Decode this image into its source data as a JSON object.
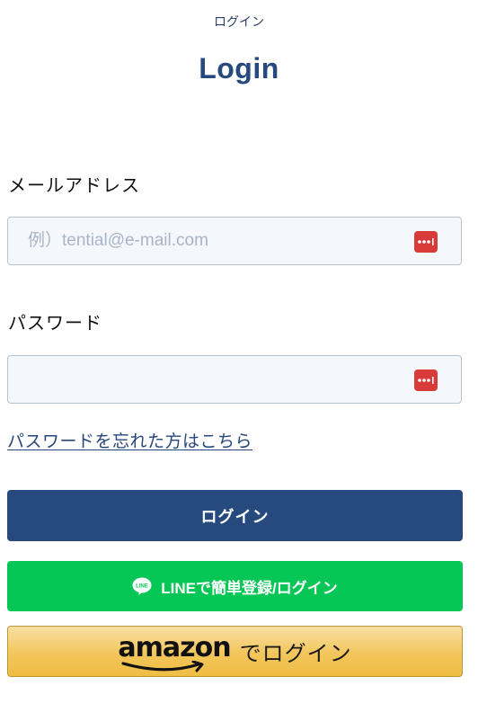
{
  "header": {
    "small_title": "ログイン",
    "title": "Login"
  },
  "email": {
    "label": "メールアドレス",
    "placeholder": "例）tential@e-mail.com",
    "value": ""
  },
  "password": {
    "label": "パスワード",
    "placeholder": "",
    "value": ""
  },
  "forgot_password": {
    "label": "パスワードを忘れた方はこちら"
  },
  "buttons": {
    "login_label": "ログイン",
    "line_label": "LINEで簡単登録/ログイン",
    "line_icon_text": "LINE",
    "amazon_logo": "amazon",
    "amazon_suffix": "でログイン"
  },
  "colors": {
    "brand_navy": "#274a7e",
    "line_green": "#06c755",
    "amazon_gold": "#f2c65b",
    "pw_manager_red": "#d93b3b"
  },
  "icons": {
    "password_manager": "password-manager-icon",
    "line": "line-logo-icon",
    "amazon_smile": "amazon-smile-icon"
  }
}
